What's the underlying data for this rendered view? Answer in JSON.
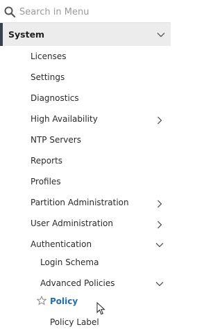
{
  "search": {
    "placeholder": "Search in Menu"
  },
  "system": {
    "label": "System"
  },
  "menu": {
    "licenses": "Licenses",
    "settings": "Settings",
    "diagnostics": "Diagnostics",
    "high_availability": "High Availability",
    "ntp_servers": "NTP Servers",
    "reports": "Reports",
    "profiles": "Profiles",
    "partition_administration": "Partition Administration",
    "user_administration": "User Administration",
    "authentication": "Authentication",
    "login_schema": "Login Schema",
    "advanced_policies": "Advanced Policies",
    "policy": "Policy",
    "policy_label": "Policy Label"
  },
  "colors": {
    "accent": "#1f6fb5",
    "selected_bar": "#36434f",
    "section_bg": "#ececec"
  },
  "icons": [
    "search-icon",
    "chevron-down-icon",
    "chevron-right-icon",
    "star-icon",
    "mouse-cursor-icon"
  ]
}
